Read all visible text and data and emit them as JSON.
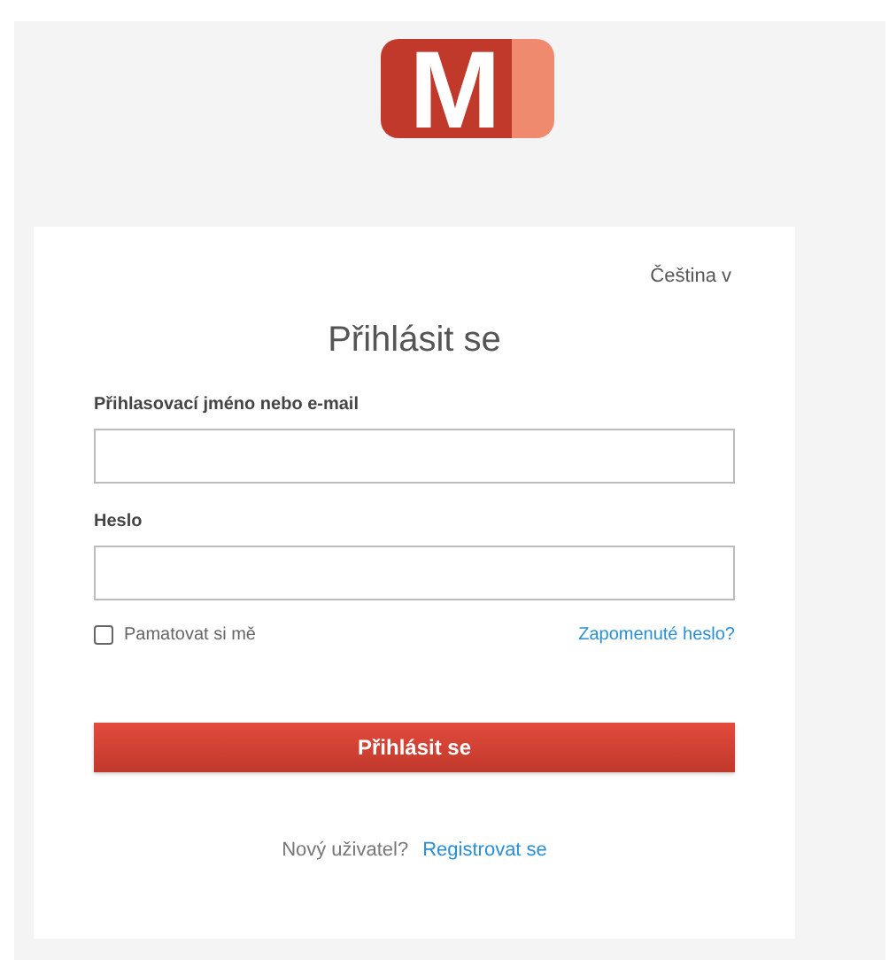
{
  "logo": {
    "letter": "M"
  },
  "language": {
    "label": "Čeština",
    "caret": "v"
  },
  "title": "Přihlásit se",
  "fields": [
    {
      "label": "Přihlasovací jméno nebo e-mail"
    },
    {
      "label": "Heslo"
    }
  ],
  "remember": {
    "label": "Pamatovat si mě",
    "checked": false
  },
  "forgot_link": "Zapomenuté heslo?",
  "submit_button": "Přihlásit se",
  "register": {
    "prompt": "Nový uživatel?",
    "link": "Registrovat se"
  }
}
